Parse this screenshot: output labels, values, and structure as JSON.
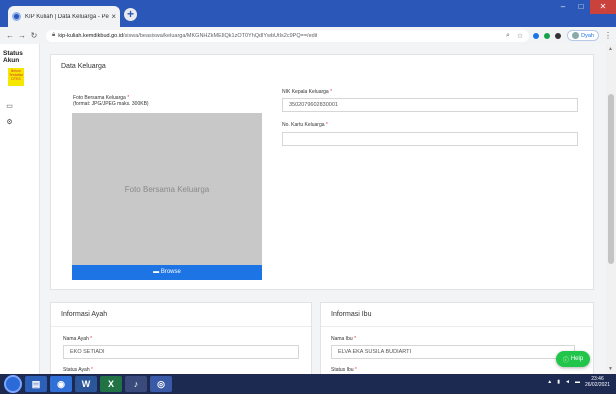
{
  "browser": {
    "tab_title": "KIP Kuliah | Data Keluarga - Perl",
    "tab_close": "×",
    "new_tab": "+",
    "url_domain": "kip-kuliah.kemdikbud.go.id",
    "url_path": "/siswa/beasiswa/keluarga/MKGNHZkMEIlQk1zOT0YhQdlYwbUtIs2c9PQ==/edit",
    "user_label": "Dyah"
  },
  "sidebar": {
    "status_title": "Status Akun",
    "status_badge": "Belum Terdaftar DTKS"
  },
  "data_keluarga": {
    "title": "Data Keluarga",
    "photo_label": "Foto Bersama Keluarga",
    "photo_hint": "(format: JPG/JPEG maks. 300KB)",
    "photo_placeholder": "Foto Bersama Keluarga",
    "browse_label": "Browse",
    "nik_label": "NIK Kepala Keluarga",
    "nik_value": "3502079602830001",
    "kk_label": "No. Kartu Keluarga",
    "kk_value": "",
    "required_mark": "*"
  },
  "ayah": {
    "title": "Informasi Ayah",
    "name_label": "Nama Ayah",
    "name_value": "EKO SETIADI",
    "status_label": "Status Ayah"
  },
  "ibu": {
    "title": "Informasi Ibu",
    "name_label": "Nama Ibu",
    "name_value": "ELVA EKA SUSILA BUDIARTI",
    "status_label": "Status Ibu"
  },
  "help_button": "Help",
  "taskbar": {
    "time": "23:46",
    "date": "26/02/2021"
  },
  "colors": {
    "chrome_blue": "#2b57b8",
    "browse_blue": "#1d74e5",
    "help_green": "#21c54a",
    "badge_yellow": "#f5e700"
  }
}
